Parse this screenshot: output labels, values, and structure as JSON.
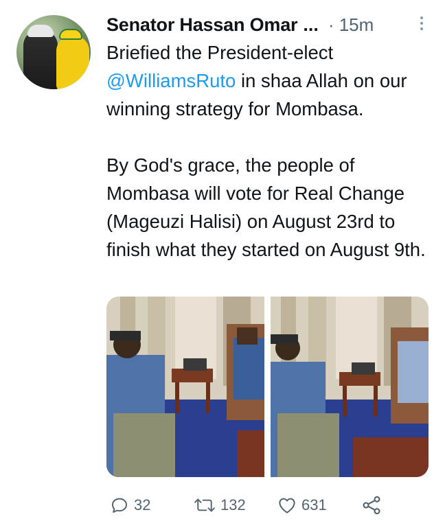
{
  "tweet": {
    "author_name": "Senator Hassan Omar",
    "name_ellipsis": "...",
    "time": "· 15m",
    "text_line1_before": "Briefied the President-elect",
    "mention": "@WilliamsRuto",
    "text_line1_after": " in shaa Allah on our winning strategy for Mombasa.",
    "paragraph2": "By God's grace, the people of Mombasa will vote for Real Change (Mageuzi Halisi) on August 23rd to finish what they started on August 9th."
  },
  "actions": {
    "replies": "32",
    "retweets": "132",
    "likes": "631"
  },
  "icons": {
    "reply": "speech-bubble-icon",
    "retweet": "retweet-arrows-icon",
    "like": "heart-icon",
    "share": "share-nodes-icon",
    "more": "vertical-dots-icon"
  },
  "colors": {
    "link": "#1d9bf0",
    "secondary": "#536471",
    "text": "#0f1419"
  }
}
